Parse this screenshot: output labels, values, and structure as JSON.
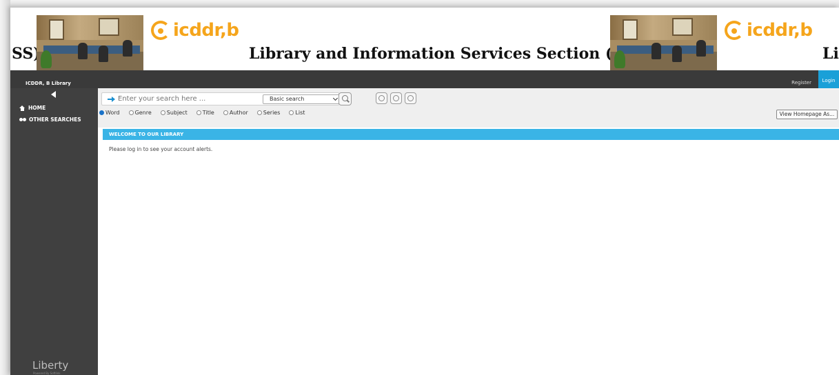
{
  "banner": {
    "title_left_fragment": "SS)",
    "logo_text": "icddr,b",
    "title": "Library and Information Services Section (LISS)",
    "title_right_fragment": "Li"
  },
  "topbar": {
    "brand": "ICDDR, B Library",
    "register_label": "Register",
    "login_label": "Login"
  },
  "sidebar": {
    "items": [
      {
        "label": "HOME",
        "icon": "home-icon"
      },
      {
        "label": "OTHER SEARCHES",
        "icon": "binoculars-icon"
      }
    ],
    "footer_brand": "Liberty",
    "footer_powered": "Powered By Softlink"
  },
  "search": {
    "placeholder": "Enter your search here ...",
    "mode": "Basic search",
    "types": [
      "Word",
      "Genre",
      "Subject",
      "Title",
      "Author",
      "Series",
      "List"
    ],
    "selected_type": "Word",
    "homepage_button": "View Homepage As..."
  },
  "content": {
    "welcome_heading": "WELCOME TO OUR LIBRARY",
    "alerts_text": "Please log in to see your account alerts."
  },
  "colors": {
    "accent": "#3ab4e6",
    "login": "#1aa0d8",
    "logo": "#f5a51c",
    "topbar": "#3a3a3a",
    "sidebar": "#404040"
  }
}
